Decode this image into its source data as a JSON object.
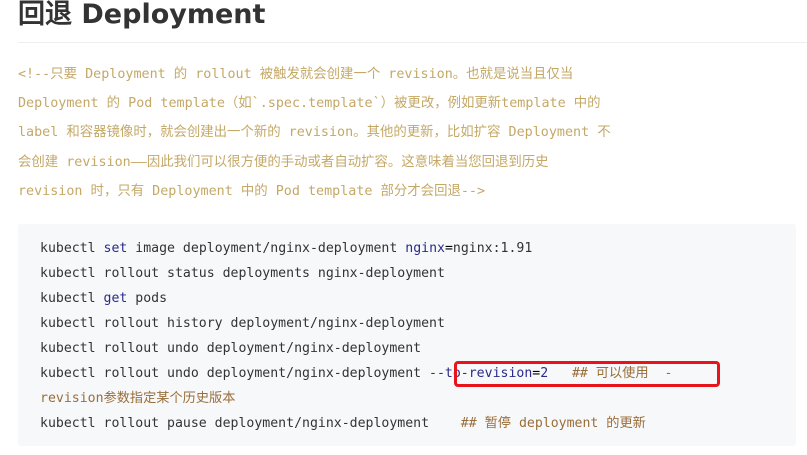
{
  "heading": "回退 Deployment",
  "comment_lines": [
    "<!--只要 Deployment 的 rollout 被触发就会创建一个 revision。也就是说当且仅当",
    "Deployment 的 Pod template（如`.spec.template`）被更改，例如更新template 中的",
    "label 和容器镜像时，就会创建出一个新的 revision。其他的更新，比如扩容 Deployment 不",
    "会创建 revision——因此我们可以很方便的手动或者自动扩容。这意味着当您回退到历史",
    "revision 时，只有 Deployment 中的 Pod template 部分才会回退-->"
  ],
  "code": {
    "line1": {
      "cmd": "kubectl ",
      "kw": "set",
      "mid": " image deployment/nginx-deployment ",
      "kw2": "nginx",
      "op": "=",
      "rest": "nginx:1.91"
    },
    "line2": "kubectl rollout status deployments nginx-deployment",
    "line3": {
      "cmd": "kubectl ",
      "kw": "get",
      "rest": " pods"
    },
    "line4": "kubectl rollout history deployment/nginx-deployment",
    "line5": "kubectl rollout undo deployment/nginx-deployment",
    "line6": {
      "cmd": "kubectl rollout undo deployment/nginx-deployment",
      "flag": " --to-revision",
      "op": "=",
      "num": "2",
      "comment": "   ## 可以使用 ",
      "tail": " -"
    },
    "line7": "revision参数指定某个历史版本",
    "line8": {
      "cmd": "kubectl rollout pause deployment/nginx-deployment",
      "comment": "    ## 暂停 deployment 的更新"
    }
  },
  "colors": {
    "comment_text": "#c4a866",
    "code_bg": "#f6f8fa",
    "highlight_border": "#e8141c",
    "keyword": "#2b2a8a"
  }
}
